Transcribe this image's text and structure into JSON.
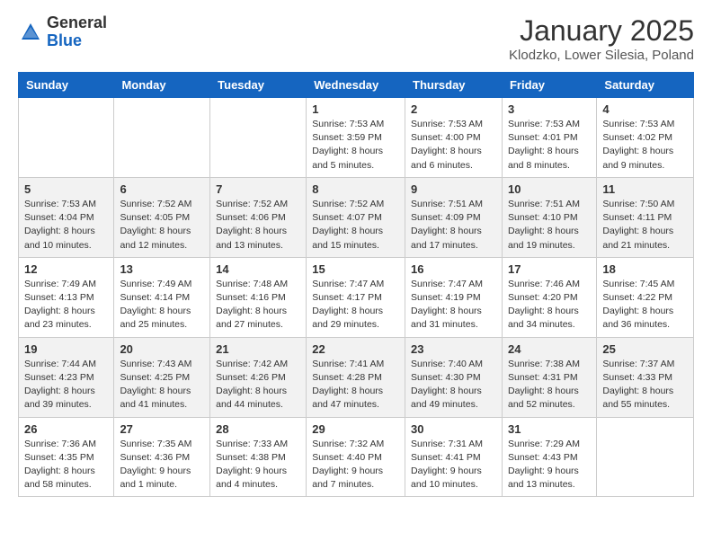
{
  "header": {
    "logo_general": "General",
    "logo_blue": "Blue",
    "month_title": "January 2025",
    "location": "Klodzko, Lower Silesia, Poland"
  },
  "days_of_week": [
    "Sunday",
    "Monday",
    "Tuesday",
    "Wednesday",
    "Thursday",
    "Friday",
    "Saturday"
  ],
  "weeks": [
    [
      {
        "day": "",
        "info": ""
      },
      {
        "day": "",
        "info": ""
      },
      {
        "day": "",
        "info": ""
      },
      {
        "day": "1",
        "info": "Sunrise: 7:53 AM\nSunset: 3:59 PM\nDaylight: 8 hours\nand 5 minutes."
      },
      {
        "day": "2",
        "info": "Sunrise: 7:53 AM\nSunset: 4:00 PM\nDaylight: 8 hours\nand 6 minutes."
      },
      {
        "day": "3",
        "info": "Sunrise: 7:53 AM\nSunset: 4:01 PM\nDaylight: 8 hours\nand 8 minutes."
      },
      {
        "day": "4",
        "info": "Sunrise: 7:53 AM\nSunset: 4:02 PM\nDaylight: 8 hours\nand 9 minutes."
      }
    ],
    [
      {
        "day": "5",
        "info": "Sunrise: 7:53 AM\nSunset: 4:04 PM\nDaylight: 8 hours\nand 10 minutes."
      },
      {
        "day": "6",
        "info": "Sunrise: 7:52 AM\nSunset: 4:05 PM\nDaylight: 8 hours\nand 12 minutes."
      },
      {
        "day": "7",
        "info": "Sunrise: 7:52 AM\nSunset: 4:06 PM\nDaylight: 8 hours\nand 13 minutes."
      },
      {
        "day": "8",
        "info": "Sunrise: 7:52 AM\nSunset: 4:07 PM\nDaylight: 8 hours\nand 15 minutes."
      },
      {
        "day": "9",
        "info": "Sunrise: 7:51 AM\nSunset: 4:09 PM\nDaylight: 8 hours\nand 17 minutes."
      },
      {
        "day": "10",
        "info": "Sunrise: 7:51 AM\nSunset: 4:10 PM\nDaylight: 8 hours\nand 19 minutes."
      },
      {
        "day": "11",
        "info": "Sunrise: 7:50 AM\nSunset: 4:11 PM\nDaylight: 8 hours\nand 21 minutes."
      }
    ],
    [
      {
        "day": "12",
        "info": "Sunrise: 7:49 AM\nSunset: 4:13 PM\nDaylight: 8 hours\nand 23 minutes."
      },
      {
        "day": "13",
        "info": "Sunrise: 7:49 AM\nSunset: 4:14 PM\nDaylight: 8 hours\nand 25 minutes."
      },
      {
        "day": "14",
        "info": "Sunrise: 7:48 AM\nSunset: 4:16 PM\nDaylight: 8 hours\nand 27 minutes."
      },
      {
        "day": "15",
        "info": "Sunrise: 7:47 AM\nSunset: 4:17 PM\nDaylight: 8 hours\nand 29 minutes."
      },
      {
        "day": "16",
        "info": "Sunrise: 7:47 AM\nSunset: 4:19 PM\nDaylight: 8 hours\nand 31 minutes."
      },
      {
        "day": "17",
        "info": "Sunrise: 7:46 AM\nSunset: 4:20 PM\nDaylight: 8 hours\nand 34 minutes."
      },
      {
        "day": "18",
        "info": "Sunrise: 7:45 AM\nSunset: 4:22 PM\nDaylight: 8 hours\nand 36 minutes."
      }
    ],
    [
      {
        "day": "19",
        "info": "Sunrise: 7:44 AM\nSunset: 4:23 PM\nDaylight: 8 hours\nand 39 minutes."
      },
      {
        "day": "20",
        "info": "Sunrise: 7:43 AM\nSunset: 4:25 PM\nDaylight: 8 hours\nand 41 minutes."
      },
      {
        "day": "21",
        "info": "Sunrise: 7:42 AM\nSunset: 4:26 PM\nDaylight: 8 hours\nand 44 minutes."
      },
      {
        "day": "22",
        "info": "Sunrise: 7:41 AM\nSunset: 4:28 PM\nDaylight: 8 hours\nand 47 minutes."
      },
      {
        "day": "23",
        "info": "Sunrise: 7:40 AM\nSunset: 4:30 PM\nDaylight: 8 hours\nand 49 minutes."
      },
      {
        "day": "24",
        "info": "Sunrise: 7:38 AM\nSunset: 4:31 PM\nDaylight: 8 hours\nand 52 minutes."
      },
      {
        "day": "25",
        "info": "Sunrise: 7:37 AM\nSunset: 4:33 PM\nDaylight: 8 hours\nand 55 minutes."
      }
    ],
    [
      {
        "day": "26",
        "info": "Sunrise: 7:36 AM\nSunset: 4:35 PM\nDaylight: 8 hours\nand 58 minutes."
      },
      {
        "day": "27",
        "info": "Sunrise: 7:35 AM\nSunset: 4:36 PM\nDaylight: 9 hours\nand 1 minute."
      },
      {
        "day": "28",
        "info": "Sunrise: 7:33 AM\nSunset: 4:38 PM\nDaylight: 9 hours\nand 4 minutes."
      },
      {
        "day": "29",
        "info": "Sunrise: 7:32 AM\nSunset: 4:40 PM\nDaylight: 9 hours\nand 7 minutes."
      },
      {
        "day": "30",
        "info": "Sunrise: 7:31 AM\nSunset: 4:41 PM\nDaylight: 9 hours\nand 10 minutes."
      },
      {
        "day": "31",
        "info": "Sunrise: 7:29 AM\nSunset: 4:43 PM\nDaylight: 9 hours\nand 13 minutes."
      },
      {
        "day": "",
        "info": ""
      }
    ]
  ]
}
